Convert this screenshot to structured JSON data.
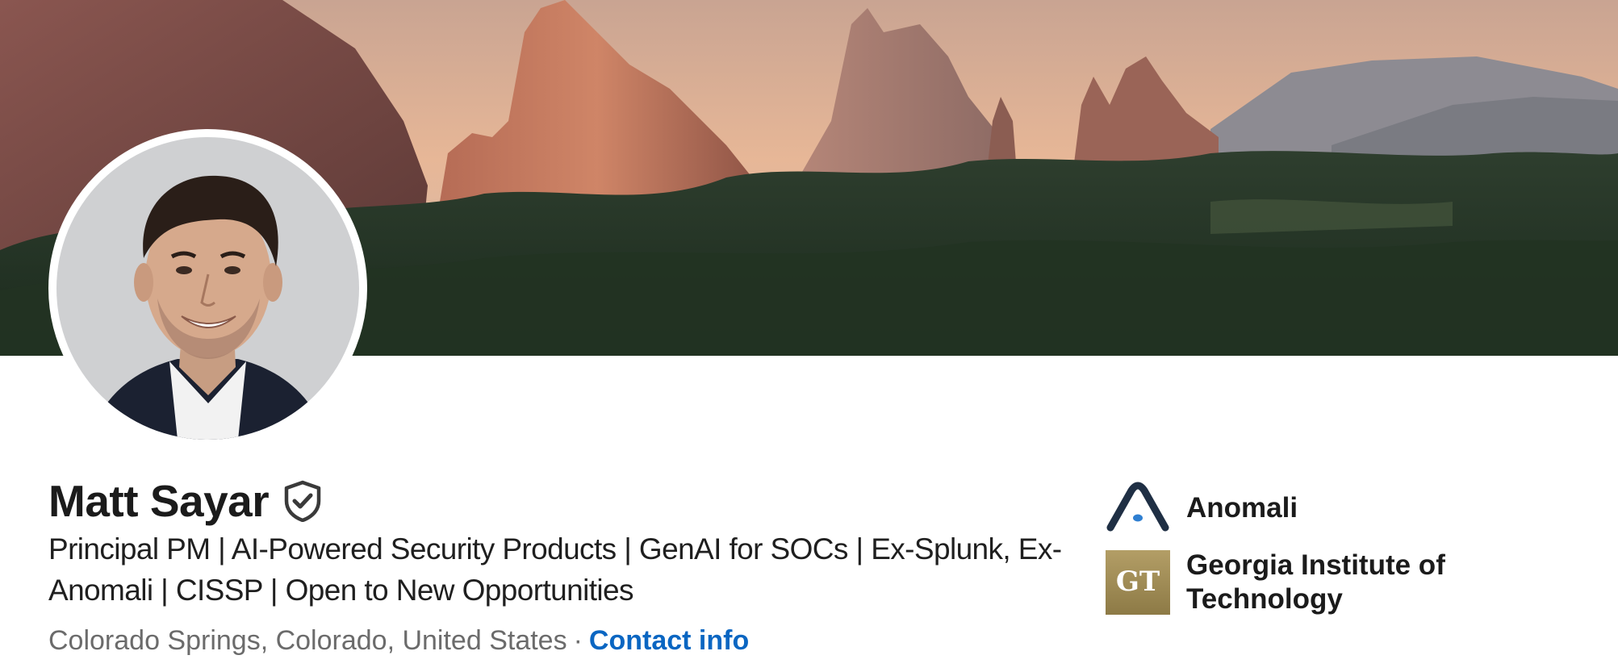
{
  "profile": {
    "name": "Matt Sayar",
    "headline": "Principal PM | AI-Powered Security Products | GenAI for SOCs | Ex-Splunk, Ex-Anomali | CISSP | Open to New Opportunities",
    "location": "Colorado Springs, Colorado, United States",
    "separator": "·",
    "contact_label": "Contact info",
    "verified_icon": "verified-shield-icon"
  },
  "organizations": {
    "current_company": "Anomali",
    "education": "Georgia Institute of Technology",
    "education_logo_text": "GT"
  },
  "colors": {
    "link": "#0a66c2",
    "text": "#1b1b1b",
    "muted": "#6b6b6b",
    "gt_gold": "#a4915c",
    "anomali_navy": "#1f2f44",
    "anomali_blue": "#2f7fd1"
  }
}
